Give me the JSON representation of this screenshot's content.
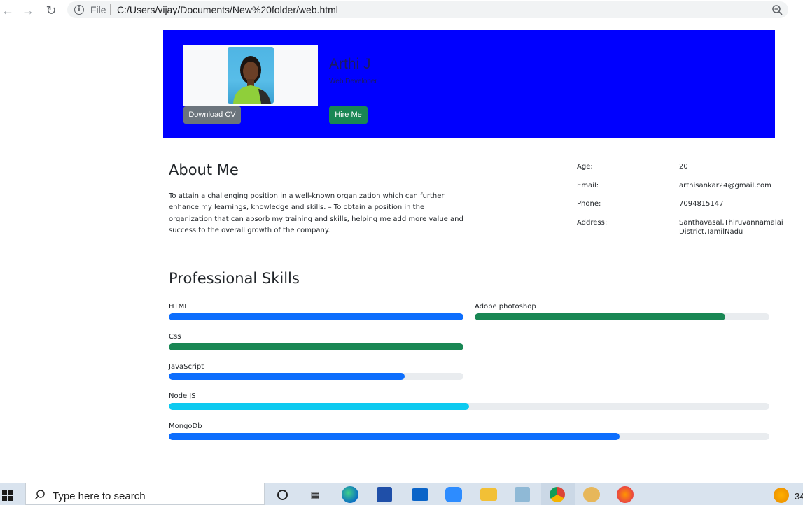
{
  "browser": {
    "file_label": "File",
    "url": "C:/Users/vijay/Documents/New%20folder/web.html"
  },
  "profile": {
    "name": "Arthi J",
    "role": "Web Developer",
    "download_cv": "Download CV",
    "hire_me": "Hire Me"
  },
  "about": {
    "title": "About Me",
    "text": "To attain a challenging position in a well-known organization which can further enhance my learnings, knowledge and skills. – To obtain a position in the organization that can absorb my training and skills, helping me add more value and success to the overall growth of the company."
  },
  "info": [
    {
      "label": "Age:",
      "value": "20"
    },
    {
      "label": "Email:",
      "value": "arthisankar24@gmail.com"
    },
    {
      "label": "Phone:",
      "value": "7094815147"
    },
    {
      "label": "Address:",
      "value": "Santhavasal,Thiruvannamalai District,TamilNadu"
    }
  ],
  "skills": {
    "title": "Professional Skills",
    "items": [
      {
        "name": "HTML",
        "percent": 100,
        "color": "#0d6efd"
      },
      {
        "name": "Adobe photoshop",
        "percent": 85,
        "color": "#198754"
      },
      {
        "name": "Css",
        "percent": 100,
        "color": "#198754"
      },
      {
        "name": "JavaScript",
        "percent": 80,
        "color": "#0d6efd"
      },
      {
        "name": "Node JS",
        "percent": 50,
        "color": "#0dcaf0"
      },
      {
        "name": "MongoDb",
        "percent": 75,
        "color": "#0d6efd"
      }
    ]
  },
  "taskbar": {
    "search_placeholder": "Type here to search",
    "tray_text": "34"
  }
}
